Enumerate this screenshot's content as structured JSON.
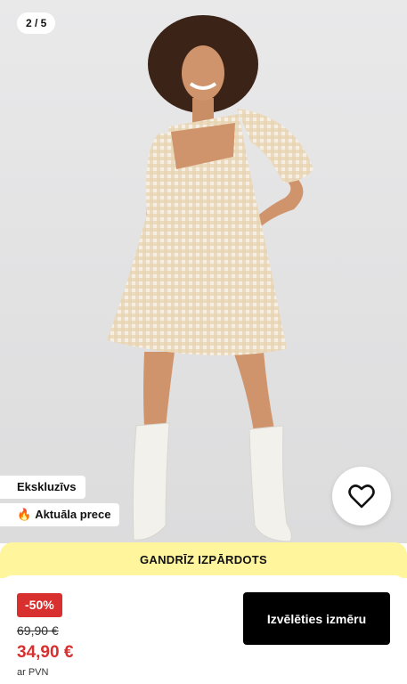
{
  "gallery": {
    "counter": "2 / 5"
  },
  "badges": {
    "exclusive": "Ekskluzīvs",
    "hot": "Aktuāla prece",
    "hot_icon": "fire-icon"
  },
  "favorite": {
    "icon": "heart-icon"
  },
  "banner": {
    "text": "GANDRĪZ IZPĀRDOTS",
    "color": "#fff59d"
  },
  "pricing": {
    "discount": "-50%",
    "old_price": "69,90 €",
    "new_price": "34,90 €",
    "vat_note": "ar PVN",
    "accent": "#d8302f"
  },
  "actions": {
    "select_size": "Izvēlēties izmēru"
  }
}
